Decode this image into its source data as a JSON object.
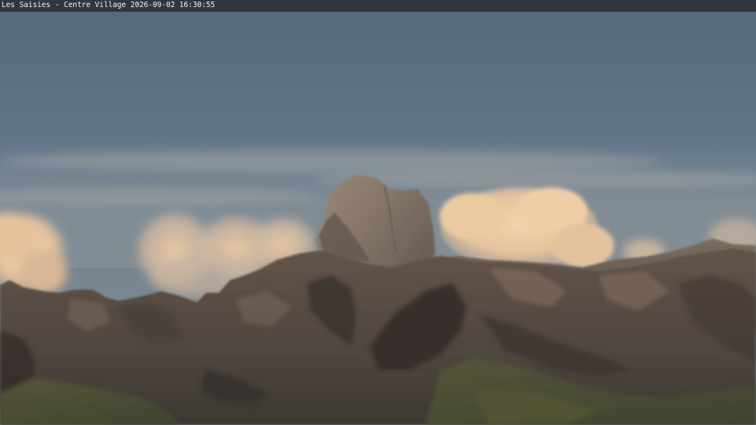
{
  "overlay": {
    "caption": "Les Saisies - Centre Village 2026-09-02 16:30:55"
  },
  "colors": {
    "sky_top": "#5a6c7c",
    "sky_mid": "#697c8a",
    "sky_horizon": "#8b959b",
    "cloud_lit": "#ecc79d",
    "cloud_shadow": "#c9a987",
    "peak_lit": "#8e7e6e",
    "rock_far": "#77695c",
    "rock_mid": "#5e5148",
    "rock_dark": "#3b3430",
    "slope_green": "#4f5337",
    "overlay_bar": "#2c2e34",
    "overlay_text": "#f4f4f4"
  }
}
